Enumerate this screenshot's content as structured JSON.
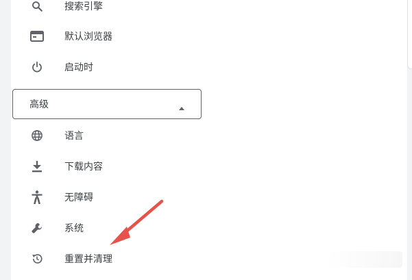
{
  "menu": {
    "items_top": [
      {
        "label": "搜索引擎",
        "icon": "search-icon"
      },
      {
        "label": "默认浏览器",
        "icon": "browser-window-icon"
      },
      {
        "label": "启动时",
        "icon": "power-icon"
      }
    ],
    "advanced": {
      "label": "高级",
      "icon": "chevron-up-icon",
      "expanded": true
    },
    "items_advanced": [
      {
        "label": "语言",
        "icon": "globe-icon"
      },
      {
        "label": "下载内容",
        "icon": "download-icon"
      },
      {
        "label": "无障碍",
        "icon": "accessibility-icon"
      },
      {
        "label": "系统",
        "icon": "wrench-icon"
      },
      {
        "label": "重置并清理",
        "icon": "history-reset-icon"
      }
    ]
  },
  "annotation": {
    "arrow_color": "#e5534b",
    "points_to": "重置并清理"
  }
}
